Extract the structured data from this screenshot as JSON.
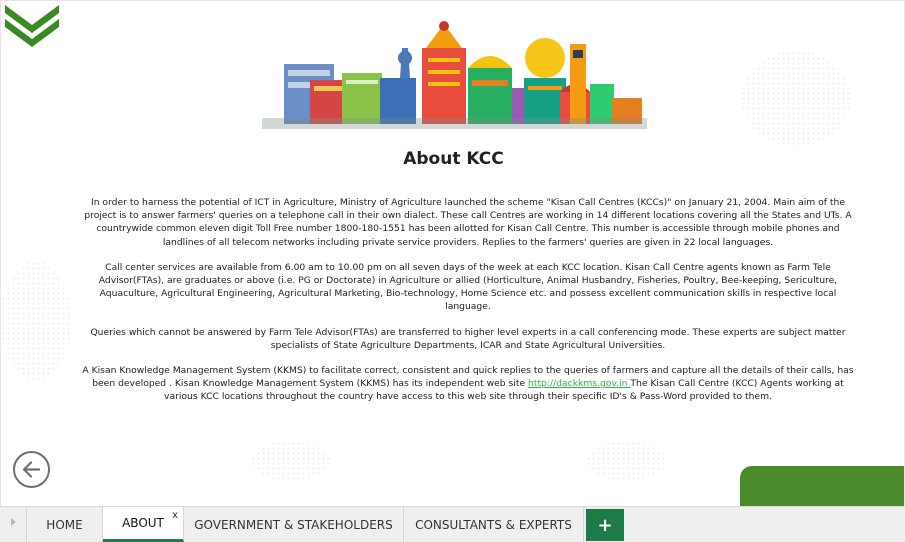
{
  "page": {
    "title": "About KCC",
    "paragraphs": {
      "p1": "In order to harness the potential of ICT in Agriculture, Ministry of Agriculture launched the scheme \"Kisan Call Centres (KCCs)\" on January 21, 2004. Main aim of the project is to answer farmers' queries on a telephone call in their own dialect. These call Centres are working in 14 different locations covering all the States and UTs. A countrywide common eleven digit Toll Free number 1800-180-1551 has been allotted for Kisan Call Centre. This number is accessible through mobile phones and landlines of all telecom networks including private service providers. Replies to the farmers' queries are given in 22 local languages.",
      "p2": "Call center services are available from 6.00 am to 10.00 pm on all seven days of the week at each KCC location. Kisan Call Centre agents known as Farm Tele Advisor(FTAs), are graduates or above (i.e. PG or Doctorate) in Agriculture or allied (Horticulture, Animal Husbandry, Fisheries, Poultry, Bee-keeping, Sericulture, Aquaculture, Agricultural Engineering, Agricultural Marketing, Bio-technology, Home Science etc. and possess excellent communication skills in respective local language.",
      "p3": "Queries which cannot be answered by Farm Tele Advisor(FTAs) are transferred to higher level experts in a call conferencing mode. These experts are subject matter specialists of State Agriculture Departments, ICAR and State Agricultural Universities.",
      "p4_before": "A Kisan Knowledge Management System (KKMS) to facilitate correct, consistent and quick replies to the queries of farmers and capture all the details of their calls, has been developed . Kisan Knowledge Management System (KKMS) has its independent web site ",
      "p4_link": "http://dackkms.gov.in ",
      "p4_after": "The Kisan Call Centre (KCC) Agents working at various KCC locations throughout the country have access to this web site through their specific ID's & Pass-Word provided to them."
    }
  },
  "icons": {
    "logo": "chevron-logo-icon",
    "back": "back-arrow-icon",
    "tab_scroll": "tab-scroll-left-icon"
  },
  "tabs": [
    {
      "label": "HOME"
    },
    {
      "label": "ABOUT",
      "close": "x"
    },
    {
      "label": "GOVERNMENT & STAKEHOLDERS"
    },
    {
      "label": "CONSULTANTS & EXPERTS"
    }
  ],
  "add_tab_label": "+",
  "colors": {
    "brand_green": "#1e7a48",
    "accent_green": "#4a8a2a",
    "link": "#2db34a"
  }
}
